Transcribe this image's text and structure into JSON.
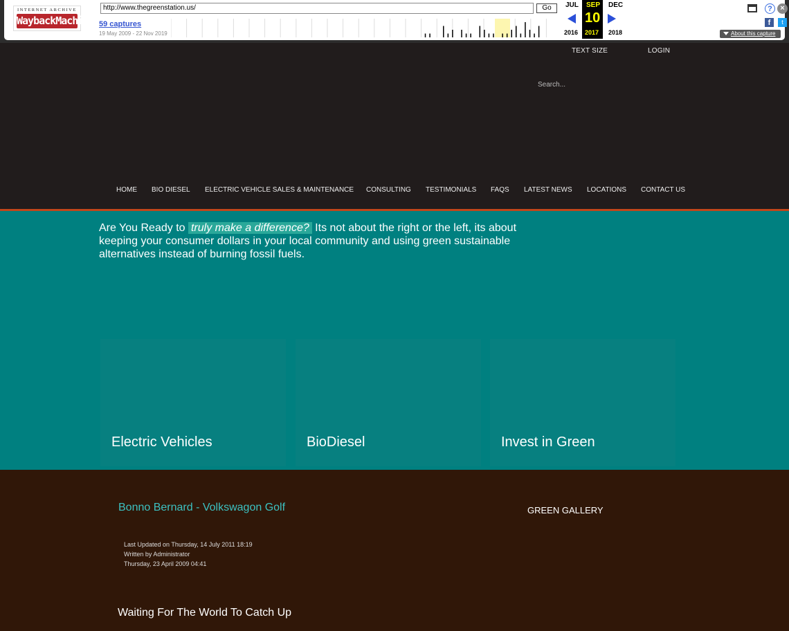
{
  "wayback": {
    "logo_top": "INTERNET ARCHIVE",
    "logo_main": "WaybackMachine",
    "url": "http://www.thegreenstation.us/",
    "go_label": "Go",
    "captures": "59 captures",
    "date_range": "19 May 2009 - 22 Nov 2019",
    "months": {
      "prev": "JUL",
      "current": "SEP",
      "next": "DEC"
    },
    "day": "10",
    "years": {
      "prev": "2016",
      "current": "2017",
      "next": "2018"
    },
    "about": "About this capture",
    "icons": [
      "window-icon",
      "help-icon",
      "close-icon",
      "facebook-icon",
      "twitter-icon"
    ],
    "sparkline_capture_counts": [
      0,
      0,
      0,
      0,
      0,
      0,
      0,
      0,
      0,
      0,
      0,
      0,
      1,
      1,
      0,
      0,
      3,
      1,
      2,
      0,
      2,
      1,
      1,
      0,
      3,
      2,
      1,
      1,
      0,
      1,
      1,
      2,
      3,
      1,
      4,
      2,
      1,
      3,
      0
    ]
  },
  "header": {
    "text_size": "TEXT SIZE",
    "login": "LOGIN",
    "search_placeholder": "Search..."
  },
  "nav": {
    "items": [
      "HOME",
      "BIO DIESEL",
      "ELECTRIC VEHICLE SALES & MAINTENANCE",
      "CONSULTING",
      "TESTIMONIALS",
      "FAQS",
      "LATEST NEWS",
      "LOCATIONS",
      "CONTACT US"
    ]
  },
  "hero": {
    "intro_before": "Are You Ready to ",
    "intro_highlight": "truly make a difference?",
    "intro_after": " Its not about the right or the left, its about keeping your consumer dollars in your local community and using green sustainable alternatives instead of burning fossil fuels.",
    "panels": [
      "Electric Vehicles",
      "BioDiesel",
      "Invest in Green"
    ]
  },
  "content": {
    "article_title": "Bonno Bernard - Volkswagon Golf",
    "last_updated": "Last Updated on Thursday, 14 July 2011 18:19",
    "author": "Written by Administrator",
    "date": "Thursday, 23 April 2009 04:41",
    "gallery": "GREEN GALLERY",
    "article_heading": "Waiting For The World To Catch Up"
  },
  "colors": {
    "hero_bg": "#008080",
    "content_bg": "#301708",
    "nav_line": "#c2461a",
    "link": "#3cc1c1"
  }
}
